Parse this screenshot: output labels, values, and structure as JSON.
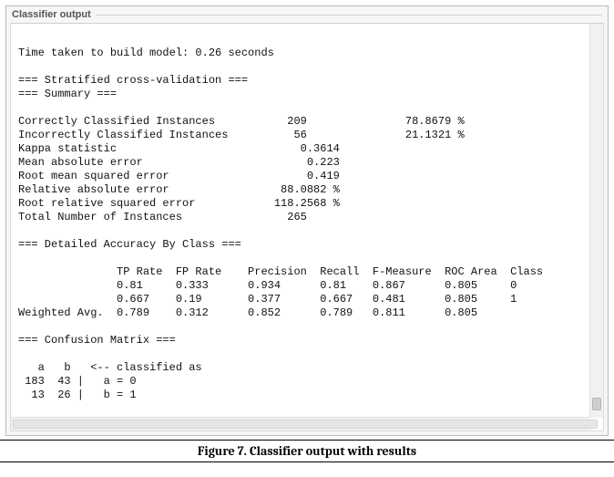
{
  "panel": {
    "title": "Classifier output"
  },
  "output": {
    "time_line": "Time taken to build model: 0.26 seconds",
    "stratified_hdr": "=== Stratified cross-validation ===",
    "summary_hdr": "=== Summary ===",
    "summary": {
      "correct": {
        "label": "Correctly Classified Instances",
        "count": "209",
        "pct": "78.8679 %"
      },
      "incorrect": {
        "label": "Incorrectly Classified Instances",
        "count": "56",
        "pct": "21.1321 %"
      },
      "kappa": {
        "label": "Kappa statistic",
        "value": "0.3614"
      },
      "mae": {
        "label": "Mean absolute error",
        "value": "0.223"
      },
      "rmse": {
        "label": "Root mean squared error",
        "value": "0.419"
      },
      "rae": {
        "label": "Relative absolute error",
        "value": "88.0882 %"
      },
      "rrse": {
        "label": "Root relative squared error",
        "value": "118.2568 %"
      },
      "total": {
        "label": "Total Number of Instances",
        "value": "265"
      }
    },
    "accuracy_hdr": "=== Detailed Accuracy By Class ===",
    "accuracy": {
      "cols": [
        "TP Rate",
        "FP Rate",
        "Precision",
        "Recall",
        "F-Measure",
        "ROC Area",
        "Class"
      ],
      "rows": [
        {
          "label": "",
          "tp": "0.81",
          "fp": "0.333",
          "prec": "0.934",
          "rec": "0.81",
          "fm": "0.867",
          "roc": "0.805",
          "class": "0"
        },
        {
          "label": "",
          "tp": "0.667",
          "fp": "0.19",
          "prec": "0.377",
          "rec": "0.667",
          "fm": "0.481",
          "roc": "0.805",
          "class": "1"
        },
        {
          "label": "Weighted Avg.",
          "tp": "0.789",
          "fp": "0.312",
          "prec": "0.852",
          "rec": "0.789",
          "fm": "0.811",
          "roc": "0.805",
          "class": ""
        }
      ]
    },
    "confusion_hdr": "=== Confusion Matrix ===",
    "confusion": {
      "header": "   a   b   <-- classified as",
      "rows": [
        {
          "a": "183",
          "b": "43",
          "label": "a = 0"
        },
        {
          "a": "13",
          "b": "26",
          "label": "b = 1"
        }
      ]
    }
  },
  "caption": "Figure 7. Classifier output with results",
  "chart_data": [
    {
      "type": "table",
      "title": "Summary",
      "rows": [
        [
          "Correctly Classified Instances",
          209,
          "78.8679 %"
        ],
        [
          "Incorrectly Classified Instances",
          56,
          "21.1321 %"
        ],
        [
          "Kappa statistic",
          0.3614
        ],
        [
          "Mean absolute error",
          0.223
        ],
        [
          "Root mean squared error",
          0.419
        ],
        [
          "Relative absolute error",
          "88.0882 %"
        ],
        [
          "Root relative squared error",
          "118.2568 %"
        ],
        [
          "Total Number of Instances",
          265
        ]
      ]
    },
    {
      "type": "table",
      "title": "Detailed Accuracy By Class",
      "columns": [
        "TP Rate",
        "FP Rate",
        "Precision",
        "Recall",
        "F-Measure",
        "ROC Area",
        "Class"
      ],
      "rows": [
        [
          0.81,
          0.333,
          0.934,
          0.81,
          0.867,
          0.805,
          "0"
        ],
        [
          0.667,
          0.19,
          0.377,
          0.667,
          0.481,
          0.805,
          "1"
        ],
        [
          0.789,
          0.312,
          0.852,
          0.789,
          0.811,
          0.805,
          "Weighted Avg."
        ]
      ]
    },
    {
      "type": "table",
      "title": "Confusion Matrix",
      "columns": [
        "a",
        "b",
        "classified as"
      ],
      "rows": [
        [
          183,
          43,
          "a = 0"
        ],
        [
          13,
          26,
          "b = 1"
        ]
      ]
    }
  ]
}
